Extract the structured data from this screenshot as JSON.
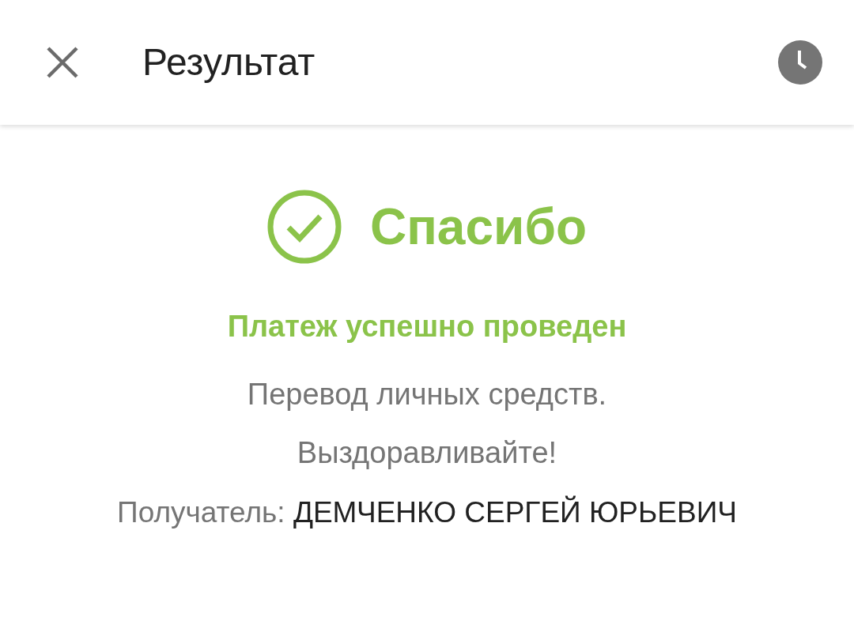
{
  "header": {
    "title": "Результат"
  },
  "result": {
    "heading": "Спасибо",
    "status": "Платеж успешно проведен",
    "lines": [
      "Перевод личных средств.",
      "Выздоравливайте!"
    ],
    "recipient": {
      "label": "Получатель:",
      "value": "ДЕМЧЕНКО СЕРГЕЙ ЮРЬЕВИЧ"
    }
  }
}
